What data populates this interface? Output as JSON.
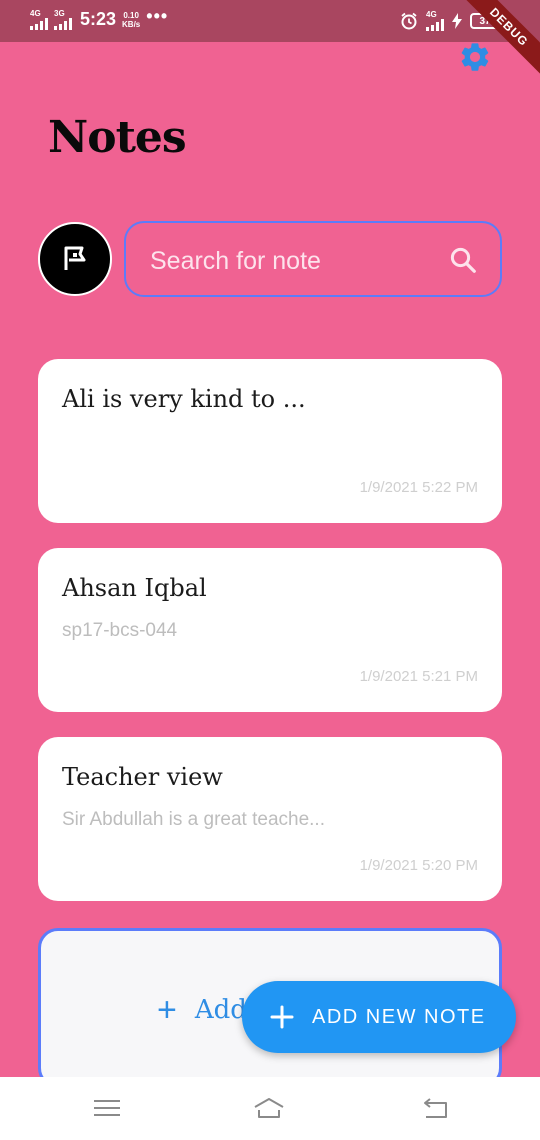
{
  "status_bar": {
    "network_1": "4G",
    "network_2": "3G",
    "time": "5:23",
    "speed_value": "0.10",
    "speed_unit": "KB/s",
    "more": "•••",
    "network_right": "4G",
    "battery": "37"
  },
  "debug_banner": "DEBUG",
  "header": {
    "title": "Notes",
    "settings_icon": "gear-icon"
  },
  "search": {
    "placeholder": "Search for note",
    "icon": "search-icon"
  },
  "avatar": {
    "icon": "flag-icon"
  },
  "notes": [
    {
      "title": "Ali is very kind to ...",
      "subtitle": "",
      "date": "1/9/2021 5:22 PM"
    },
    {
      "title": "Ahsan Iqbal",
      "subtitle": "sp17-bcs-044",
      "date": "1/9/2021 5:21 PM"
    },
    {
      "title": "Teacher view",
      "subtitle": "Sir Abdullah is a great teache...",
      "date": "1/9/2021 5:20 PM"
    }
  ],
  "add_card": {
    "plus": "+",
    "label": "Add"
  },
  "fab": {
    "label": "ADD NEW NOTE",
    "icon": "plus-icon"
  },
  "nav": {
    "menu": "menu-icon",
    "home": "home-icon",
    "back": "back-icon"
  },
  "colors": {
    "background": "#f06292",
    "accent": "#2196f3",
    "border_accent": "#5c7cfa"
  }
}
